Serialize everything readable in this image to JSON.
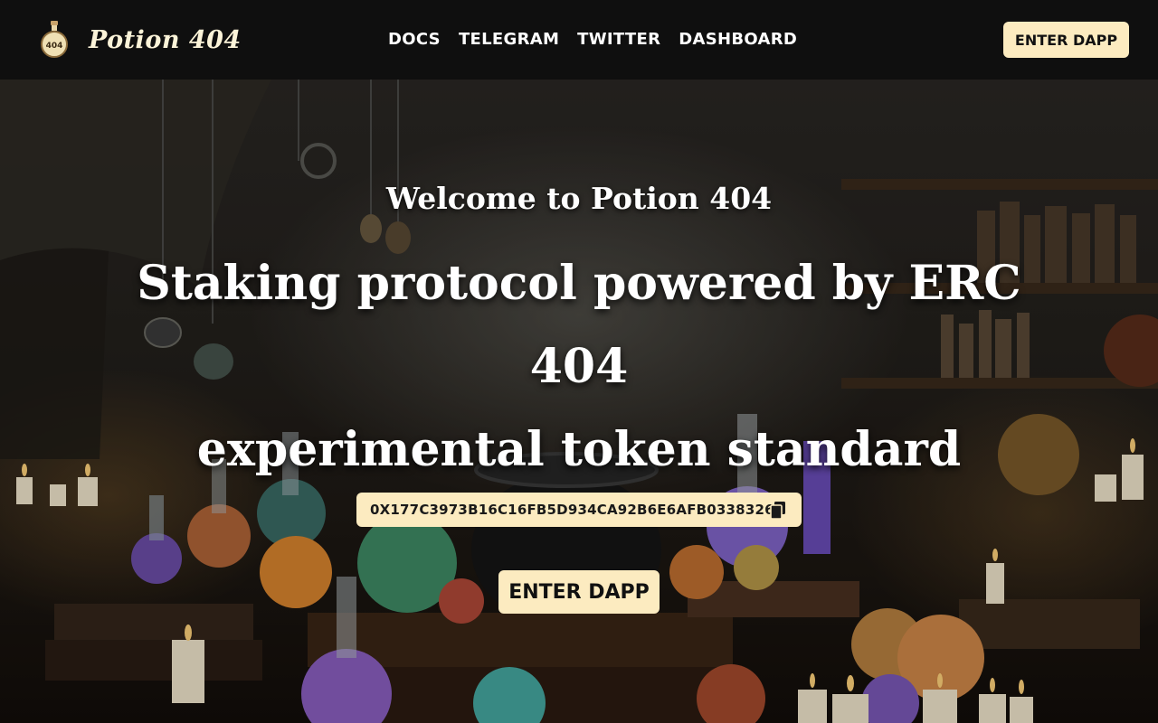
{
  "brand": {
    "name": "Potion 404",
    "logo_icon": "potion-bottle-icon",
    "logo_text": "404"
  },
  "nav": {
    "items": [
      {
        "label": "DOCS"
      },
      {
        "label": "TELEGRAM"
      },
      {
        "label": "TWITTER"
      },
      {
        "label": "DASHBOARD"
      }
    ]
  },
  "header": {
    "enter_label": "ENTER DAPP"
  },
  "hero": {
    "welcome": "Welcome to Potion 404",
    "headline_line1": "Staking protocol powered by ERC 404",
    "headline_line2": "experimental token standard",
    "contract_address": "0X177C3973B16C16FB5D934CA92B6E6AFB03383268",
    "copy_icon": "copy-icon",
    "enter_label": "ENTER DAPP",
    "background": "alchemist-laboratory-image"
  },
  "colors": {
    "accent": "#fcebc0",
    "header_bg": "#0f0f0f",
    "text_light": "#ffffff"
  }
}
